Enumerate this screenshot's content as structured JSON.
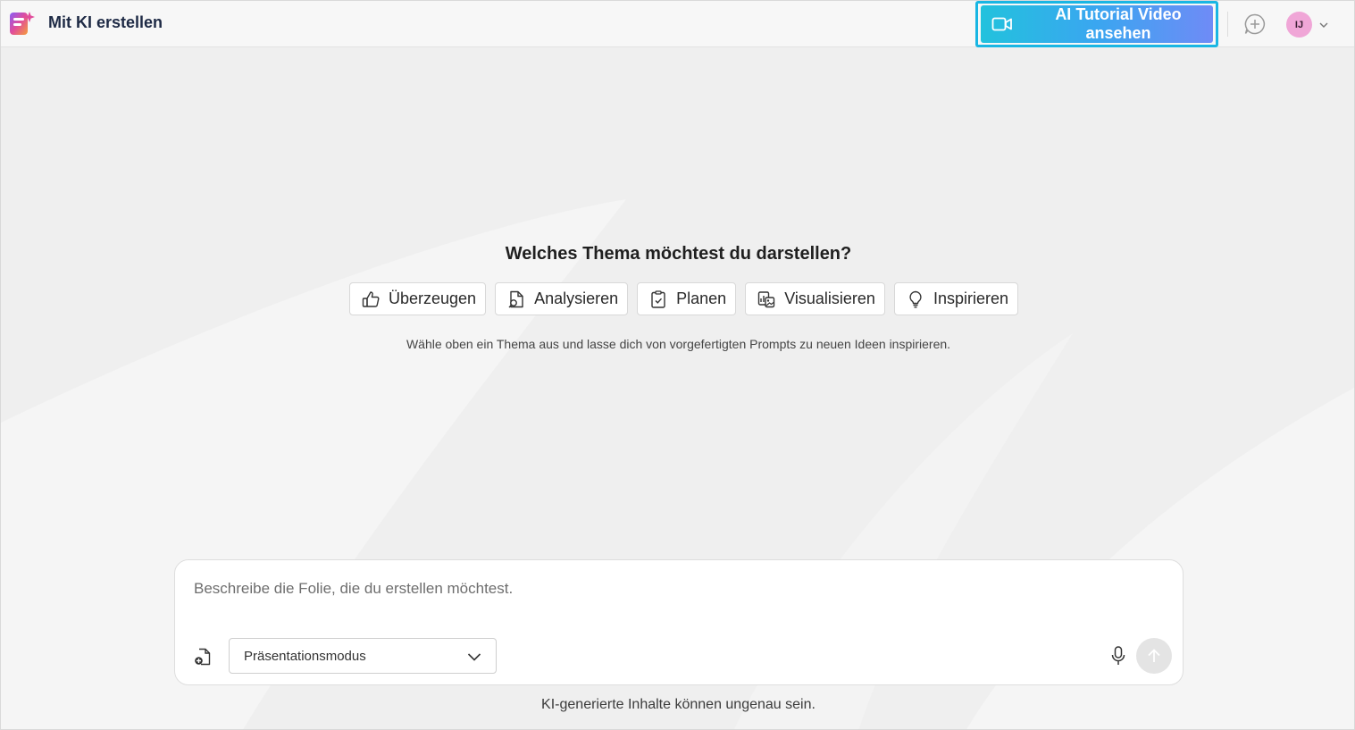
{
  "header": {
    "app_title": "Mit KI erstellen",
    "tutorial_button_label": "AI Tutorial Video ansehen",
    "avatar_initials": "IJ",
    "icons": {
      "logo": "ai-presentation-logo-icon",
      "tutorial": "video-camera-icon",
      "new_chat": "new-chat-icon",
      "avatar_menu": "chevron-down-icon"
    }
  },
  "main": {
    "heading": "Welches Thema möchtest du darstellen?",
    "topics": [
      {
        "label": "Überzeugen",
        "icon": "thumbs-up-icon"
      },
      {
        "label": "Analysieren",
        "icon": "document-search-icon"
      },
      {
        "label": "Planen",
        "icon": "clipboard-check-icon"
      },
      {
        "label": "Visualisieren",
        "icon": "image-chart-icon"
      },
      {
        "label": "Inspirieren",
        "icon": "lightbulb-icon"
      }
    ],
    "hint": "Wähle oben ein Thema aus und lasse dich von vorgefertigten Prompts zu neuen Ideen inspirieren."
  },
  "composer": {
    "placeholder": "Beschreibe die Folie, die du erstellen möchtest.",
    "value": "",
    "mode_selected": "Präsentationsmodus",
    "icons": {
      "attach": "add-file-icon",
      "mic": "microphone-icon",
      "send": "arrow-up-icon"
    }
  },
  "footer": {
    "disclaimer": "KI-generierte Inhalte können ungenau sein."
  },
  "colors": {
    "accent_start": "#22c2dd",
    "accent_end": "#6f8bf6",
    "highlight_outline": "#19b6e3",
    "avatar_bg": "#f0a6d7",
    "background": "#efefef"
  }
}
